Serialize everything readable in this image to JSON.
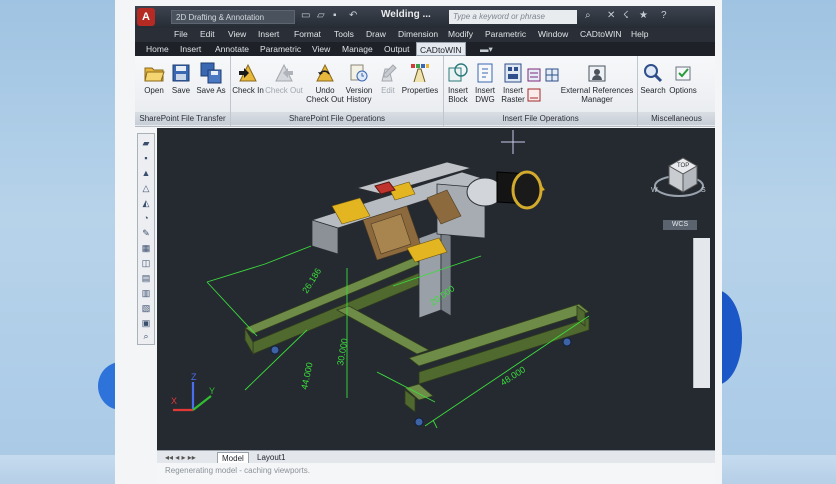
{
  "titlebar": {
    "workspace": "2D Drafting & Annotation",
    "doc_title": "Welding ...",
    "search_placeholder": "Type a keyword or phrase",
    "logo": "A"
  },
  "menu": [
    "File",
    "Edit",
    "View",
    "Insert",
    "Format",
    "Tools",
    "Draw",
    "Dimension",
    "Modify",
    "Parametric",
    "Window",
    "CADtoWIN",
    "Help"
  ],
  "tabs": [
    "Home",
    "Insert",
    "Annotate",
    "Parametric",
    "View",
    "Manage",
    "Output",
    "CADtoWIN"
  ],
  "active_tab": "CADtoWIN",
  "ribbon": {
    "buttons": {
      "open": "Open",
      "save": "Save",
      "save_as": "Save As",
      "check_in": "Check In",
      "check_out": "Check Out",
      "undo_check_out_1": "Undo",
      "undo_check_out_2": "Check Out",
      "version_history_1": "Version",
      "version_history_2": "History",
      "edit": "Edit",
      "properties": "Properties",
      "insert_block_1": "Insert",
      "insert_block_2": "Block",
      "insert_dwg_1": "Insert",
      "insert_dwg_2": "DWG",
      "insert_raster_1": "Insert",
      "insert_raster_2": "Raster",
      "ext_ref_1": "External References",
      "ext_ref_2": "Manager",
      "search": "Search",
      "options": "Options"
    },
    "panels": {
      "file_transfer": "SharePoint File Transfer",
      "file_ops": "SharePoint File Operations",
      "insert_ops": "Insert File Operations",
      "misc": "Miscellaneous"
    }
  },
  "viewcube": {
    "ucs_label": "WCS",
    "face": "TOP",
    "compass_w": "W",
    "compass_s": "S"
  },
  "dimensions": [
    "26.186",
    "30.000",
    "44.000",
    "20.000",
    "48.000"
  ],
  "ucs": {
    "x": "X",
    "y": "Y",
    "z": "Z"
  },
  "layout_tabs": [
    "Model",
    "Layout1"
  ],
  "command_line": "Regenerating model - caching viewports."
}
